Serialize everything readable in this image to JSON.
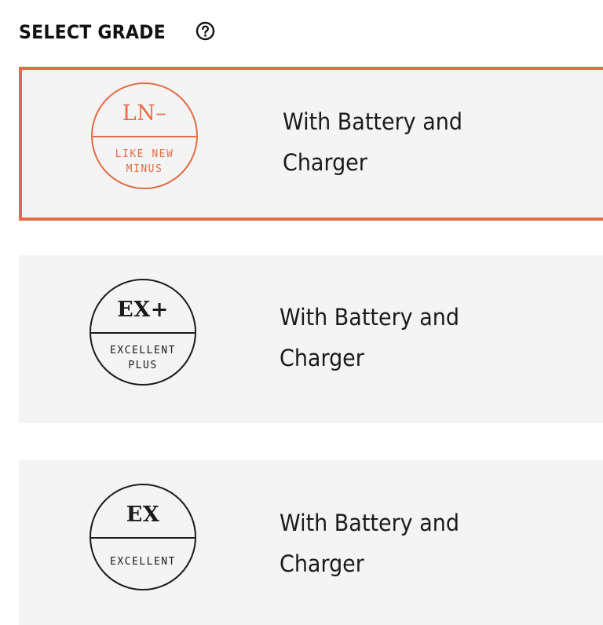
{
  "header": {
    "title": "SELECT GRADE",
    "help_icon": "question-circle-icon"
  },
  "colors": {
    "accent": "#e46c43",
    "card_background": "#f4f4f4",
    "text": "#1a1a1a"
  },
  "grades": [
    {
      "code": "LN–",
      "name": "LIKE NEW MINUS",
      "description": "With Battery and Charger",
      "selected": true
    },
    {
      "code": "EX+",
      "name": "EXCELLENT PLUS",
      "description": "With Battery and Charger",
      "selected": false
    },
    {
      "code": "EX",
      "name": "EXCELLENT",
      "description": "With Battery and Charger",
      "selected": false
    }
  ]
}
